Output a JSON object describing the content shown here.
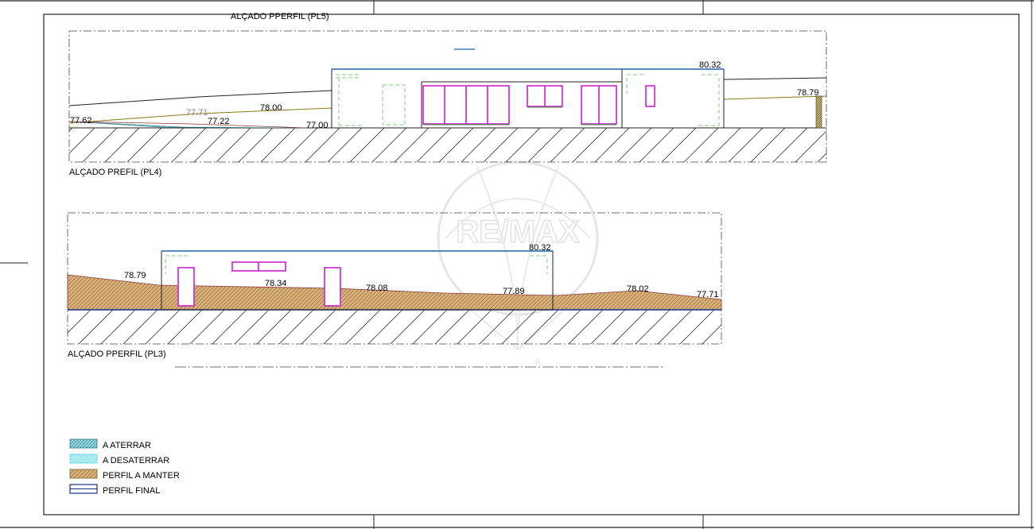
{
  "header_title": "ALÇADO PPERFIL (PL5)",
  "elevations": {
    "pl4": {
      "label": "ALÇADO PREFIL (PL4)",
      "levels": [
        "77.62",
        "77.71",
        "78.00",
        "77.22",
        "77.00",
        "80.32",
        "78.79"
      ]
    },
    "pl3": {
      "label": "ALÇADO PPERFIL (PL3)",
      "levels": [
        "78.79",
        "78.34",
        "78.08",
        "80.32",
        "77.89",
        "78.02",
        "77.71"
      ]
    }
  },
  "legend": [
    {
      "label": "A ATERRAR",
      "color": "#36a6b8"
    },
    {
      "label": "A DESATERRAR",
      "color": "#52d6e6"
    },
    {
      "label": "PERFIL A MANTER",
      "color": "#b5793c"
    },
    {
      "label": "PERFIL FINAL",
      "color": "#1a2e8f"
    }
  ],
  "watermark": {
    "text": "RE/MAX",
    "registered": "®"
  },
  "colors": {
    "outline": "#1a1a1a",
    "roof": "#1f63a8",
    "window": "#cc22cc",
    "hidden": "#7bd67b",
    "soil": "#c9a46a",
    "ground_line": "#7a6a1a"
  }
}
